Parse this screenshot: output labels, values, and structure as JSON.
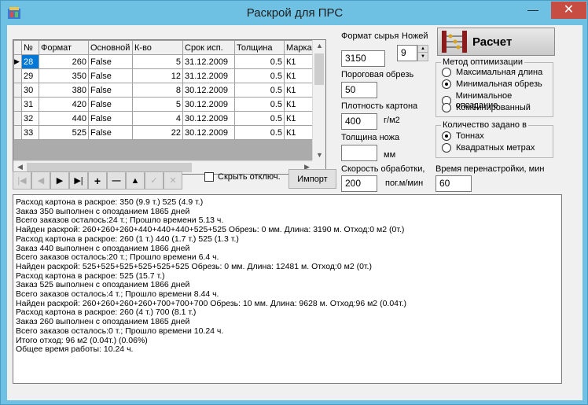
{
  "window": {
    "title": "Раскрой для ПРС",
    "minimize": "—",
    "maximize": "☐",
    "close": "✕"
  },
  "grid": {
    "columns": [
      "№",
      "Формат",
      "Основной",
      "К-во",
      "Срок исп.",
      "Толщина",
      "Марка"
    ],
    "rows": [
      [
        "28",
        "260",
        "False",
        "5",
        "31.12.2009",
        "0.5",
        "К1"
      ],
      [
        "29",
        "350",
        "False",
        "12",
        "31.12.2009",
        "0.5",
        "К1"
      ],
      [
        "30",
        "380",
        "False",
        "8",
        "30.12.2009",
        "0.5",
        "К1"
      ],
      [
        "31",
        "420",
        "False",
        "5",
        "30.12.2009",
        "0.5",
        "К1"
      ],
      [
        "32",
        "440",
        "False",
        "4",
        "30.12.2009",
        "0.5",
        "К1"
      ],
      [
        "33",
        "525",
        "False",
        "22",
        "30.12.2009",
        "0.5",
        "К1"
      ]
    ],
    "current_indicator": "▶"
  },
  "navigator": [
    "|◀",
    "◀",
    "▶",
    "▶|",
    "+",
    "—",
    "▲",
    "✓",
    "✕"
  ],
  "hide_disabled_label": "Скрыть отключ.",
  "import_label": "Импорт",
  "calc_label": "Расчет",
  "fields": {
    "format_label": "Формат сырья",
    "format_value": "3150",
    "knives_label": "Ножей",
    "knives_value": "9",
    "threshold_label": "Пороговая обрезь",
    "threshold_value": "50",
    "density_label": "Плотность картона",
    "density_value": "400",
    "density_unit": "г/м2",
    "knife_thickness_label": "Толщина ножа",
    "knife_thickness_value": "",
    "knife_thickness_unit": "мм",
    "speed_label": "Скорость обработки,",
    "speed_value": "200",
    "speed_unit": "пог.м/мин",
    "changeover_label": "Время перенастройки, мин",
    "changeover_value": "60"
  },
  "optimization": {
    "caption": "Метод оптимизации",
    "options": [
      "Максимальная длина",
      "Минимальная обрезь",
      "Минимальное опоздание",
      "Комбинированный"
    ],
    "selected": 1
  },
  "quantity": {
    "caption": "Количество задано в",
    "options": [
      "Тоннах",
      "Квадратных метрах"
    ],
    "selected": 0
  },
  "log": [
    "Расход картона в раскрое: 350 (9.9 т.) 525 (4.9 т.)",
    "Заказ 350 выполнен с опозданием 1865 дней",
    "Всего заказов осталось:24 т.; Прошло времени 5.13 ч.",
    "Найден раскрой: 260+260+260+440+440+440+525+525 Обрезь: 0 мм. Длина: 3190 м. Отход:0 м2 (0т.)",
    "Расход картона в раскрое: 260 (1 т.) 440 (1.7 т.) 525 (1.3 т.)",
    "Заказ 440 выполнен с опозданием 1866 дней",
    "Всего заказов осталось:20 т.; Прошло времени 6.4 ч.",
    "Найден раскрой: 525+525+525+525+525+525 Обрезь: 0 мм. Длина: 12481 м. Отход:0 м2 (0т.)",
    "Расход картона в раскрое: 525 (15.7 т.)",
    "Заказ 525 выполнен с опозданием 1866 дней",
    "Всего заказов осталось:4 т.; Прошло времени 8.44 ч.",
    "Найден раскрой: 260+260+260+260+700+700+700 Обрезь: 10 мм. Длина: 9628 м. Отход:96 м2 (0.04т.)",
    "Расход картона в раскрое: 260 (4 т.) 700 (8.1 т.)",
    "Заказ 260 выполнен с опозданием 1865 дней",
    "Всего заказов осталось:0 т.; Прошло времени 10.24 ч.",
    "Итого отход: 96 м2 (0.04т.) (0.06%)",
    "Общее время работы: 10.24 ч."
  ]
}
